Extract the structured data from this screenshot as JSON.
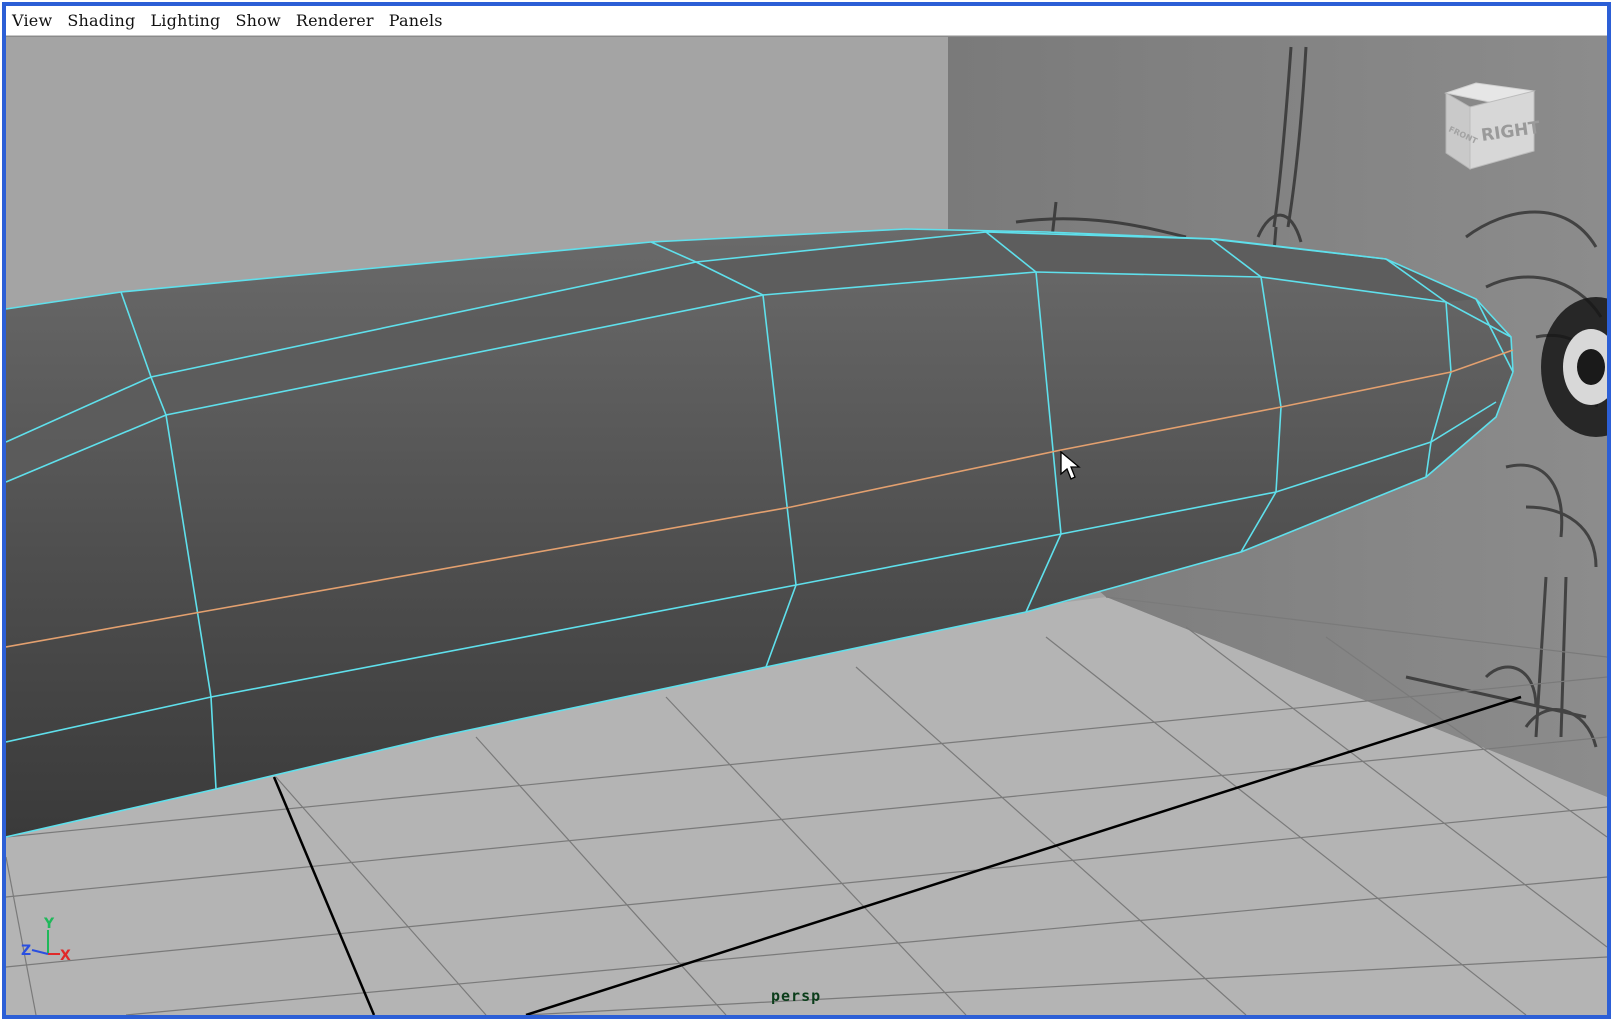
{
  "menu": {
    "items": [
      "View",
      "Shading",
      "Lighting",
      "Show",
      "Renderer",
      "Panels"
    ]
  },
  "viewport": {
    "camera_label": "persp",
    "viewcube_face": "RIGHT",
    "viewcube_side": "FRONT",
    "axis_labels": {
      "x": "X",
      "y": "Y",
      "z": "Z"
    }
  },
  "colors": {
    "window_border": "#2c5fd6",
    "wireframe": "#5fe0ec",
    "selected_edge": "#e3a06f",
    "mesh": "#565656",
    "grid_floor": "#b4b4b4",
    "backdrop": "#a4a4a4",
    "axis_x": "#e02a2a",
    "axis_y": "#1fb85a",
    "axis_z": "#2a4fe0"
  },
  "icons": {
    "cursor": "arrow-cursor-icon",
    "viewcube": "view-cube-icon",
    "axes": "axis-gizmo-icon"
  }
}
